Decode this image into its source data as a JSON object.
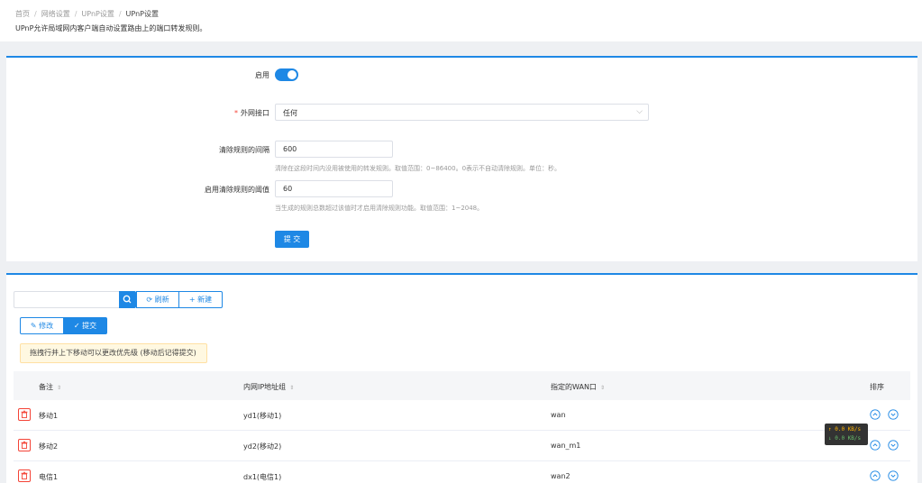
{
  "breadcrumb": [
    "首页",
    "网络设置",
    "UPnP设置",
    "UPnP设置"
  ],
  "page_description": "UPnP允许局域网内客户端自动设置路由上的端口转发规则。",
  "form": {
    "enable_label": "启用",
    "enabled": true,
    "wan_label": "外网接口",
    "wan_value": "任何",
    "clean_interval_label": "清除规则的间隔",
    "clean_interval_value": "600",
    "clean_interval_hint": "清除在这段时间内没用被使用的转发规则。取值范围：0~86400。0表示不自动清除规则。单位：秒。",
    "threshold_label": "启用清除规则的阈值",
    "threshold_value": "60",
    "threshold_hint": "当生成的规则总数超过该值时才启用清除规则功能。取值范围：1~2048。",
    "submit_label": "提 交"
  },
  "toolbar": {
    "search_placeholder": "",
    "refresh_label": "刷新",
    "new_label": "新建",
    "edit_label": "修改",
    "commit_label": "提交"
  },
  "notice": "拖拽行并上下移动可以更改优先级 (移动后记得提交)",
  "table": {
    "columns": [
      "备注",
      "内网IP地址组",
      "指定的WAN口",
      "排序"
    ],
    "rows": [
      {
        "remark": "移动1",
        "ip_group": "yd1(移动1)",
        "wan": "wan"
      },
      {
        "remark": "移动2",
        "ip_group": "yd2(移动2)",
        "wan": "wan_m1"
      },
      {
        "remark": "电信1",
        "ip_group": "dx1(电信1)",
        "wan": "wan2"
      }
    ]
  },
  "speed": {
    "up": "↑ 0.0 KB/s",
    "down": "↓ 0.0 KB/s"
  },
  "colors": {
    "primary": "#1e88e5",
    "danger": "#f44336",
    "notice_bg": "#fff8e1"
  }
}
